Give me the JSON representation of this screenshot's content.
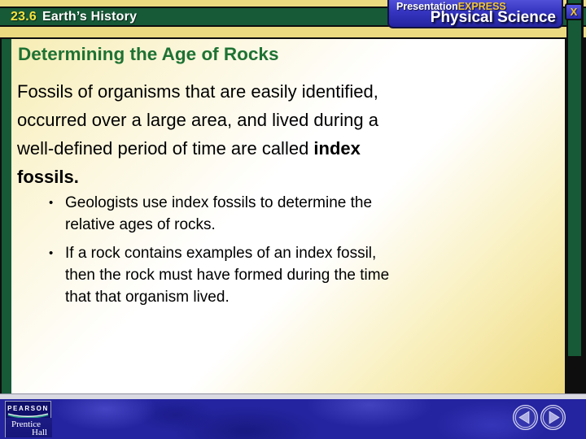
{
  "header": {
    "lesson_number": "23.6",
    "lesson_title": "Earth’s History",
    "brand": {
      "product_regular": "Presentation",
      "product_bold": "EXPRESS",
      "subject": "Physical Science"
    },
    "close_label": "X"
  },
  "slide": {
    "title": "Determining the Age of Rocks",
    "paragraph_lines": [
      {
        "text": "Fossils of organisms that are easily identified,",
        "bold": ""
      },
      {
        "text": "occurred over a large area, and lived during a",
        "bold": ""
      },
      {
        "text": "well-defined period of time are called ",
        "bold": "index"
      },
      {
        "text": "",
        "bold": "fossils."
      }
    ],
    "bullet_glyph": "•",
    "bullets": [
      {
        "lines": [
          "Geologists use index fossils to determine the",
          "relative ages of rocks."
        ]
      },
      {
        "lines": [
          "If a rock contains examples of an index fossil,",
          "then the rock must have formed during the time",
          "that that organism lived."
        ]
      }
    ]
  },
  "footer": {
    "publisher": {
      "name": "PEARSON",
      "imprint_line1": "Prentice",
      "imprint_line2": "Hall"
    }
  },
  "colors": {
    "header_green": "#175a38",
    "accent_gold": "#ecda80",
    "title_green": "#1e7233",
    "brand_blue": "#3434c0",
    "express_gold": "#f2c63c",
    "footer_blue": "#2424a0",
    "pearson_navy": "#10106a",
    "nav_lavender": "#aeaee2"
  }
}
